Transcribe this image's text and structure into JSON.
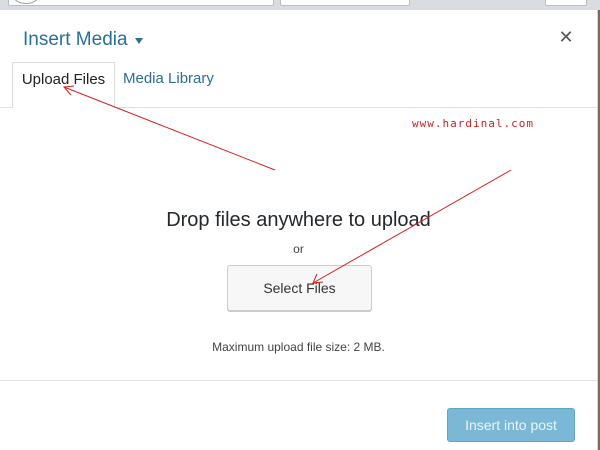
{
  "modal": {
    "title": "Insert Media",
    "close_symbol": "✕"
  },
  "tabs": [
    {
      "label": "Upload Files",
      "active": true
    },
    {
      "label": "Media Library",
      "active": false
    }
  ],
  "uploader": {
    "heading": "Drop files anywhere to upload",
    "or_text": "or",
    "select_button_label": "Select Files",
    "max_size_text": "Maximum upload file size: 2 MB."
  },
  "footer": {
    "insert_button_label": "Insert into post"
  },
  "watermark": "www.hardinal.com",
  "colors": {
    "accent": "#2a6f95",
    "primary_button_disabled": "#7ab8d6",
    "annotation": "#d42020"
  },
  "icons": {
    "title_dropdown": "caret-down-icon",
    "close": "close-icon"
  }
}
